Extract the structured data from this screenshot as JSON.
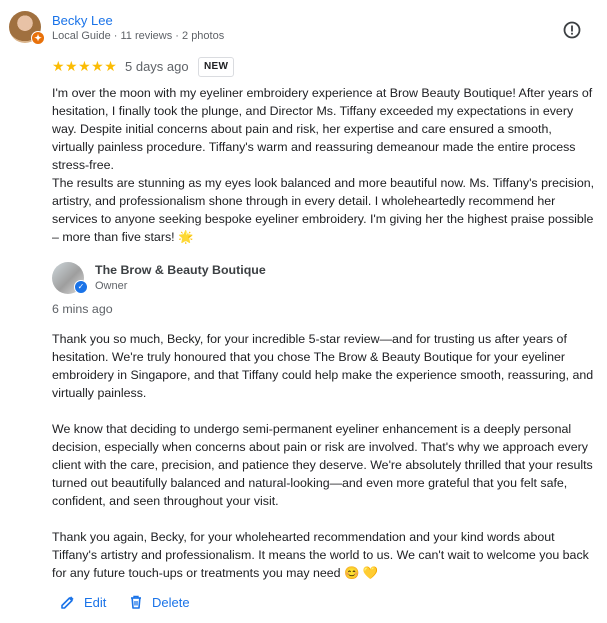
{
  "review": {
    "reviewer_name": "Becky Lee",
    "reviewer_meta": "Local Guide · 11 reviews · 2 photos",
    "rating": 5,
    "stars_display": "★★★★★",
    "time": "5 days ago",
    "badge": "NEW",
    "paragraphs": [
      "I'm over the moon with my eyeliner embroidery experience at Brow Beauty Boutique! After years of hesitation, I finally took the plunge, and Director Ms. Tiffany exceeded my expectations in every way. Despite initial concerns about pain and risk, her expertise and care ensured a smooth, virtually painless procedure. Tiffany's warm and reassuring demeanour made the entire process stress-free.",
      "The results are stunning as my eyes look balanced and more beautiful now. Ms. Tiffany's precision, artistry, and professionalism shone through in every detail. I wholeheartedly recommend her services to anyone seeking bespoke eyeliner embroidery. I'm giving her the highest praise possible – more than five stars! 🌟"
    ]
  },
  "reply": {
    "owner_name": "The Brow & Beauty Boutique",
    "owner_role": "Owner",
    "time": "6 mins ago",
    "paragraphs": [
      "Thank you so much, Becky, for your incredible 5-star review—and for trusting us after years of hesitation. We're truly honoured that you chose The Brow & Beauty Boutique for your eyeliner embroidery in Singapore, and that Tiffany could help make the experience smooth, reassuring, and virtually painless.",
      "We know that deciding to undergo semi-permanent eyeliner enhancement is a deeply personal decision, especially when concerns about pain or risk are involved. That's why we approach every client with the care, precision, and patience they deserve. We're absolutely thrilled that your results turned out beautifully balanced and natural-looking—and even more grateful that you felt safe, confident, and seen throughout your visit.",
      "Thank you again, Becky, for your wholehearted recommendation and your kind words about Tiffany's artistry and professionalism. It means the world to us. We can't wait to welcome you back for any future touch-ups or treatments you may need 😊 💛"
    ]
  },
  "actions": {
    "edit_label": "Edit",
    "delete_label": "Delete"
  },
  "icons": {
    "avatar": "reviewer-photo",
    "guide_badge": "local-guide-badge-icon",
    "report": "report-icon",
    "verified": "verified-check-icon",
    "edit": "pencil-icon",
    "delete": "trash-icon"
  },
  "colors": {
    "link": "#1a73e8",
    "star": "#fbbc04",
    "guide": "#e8710a"
  }
}
